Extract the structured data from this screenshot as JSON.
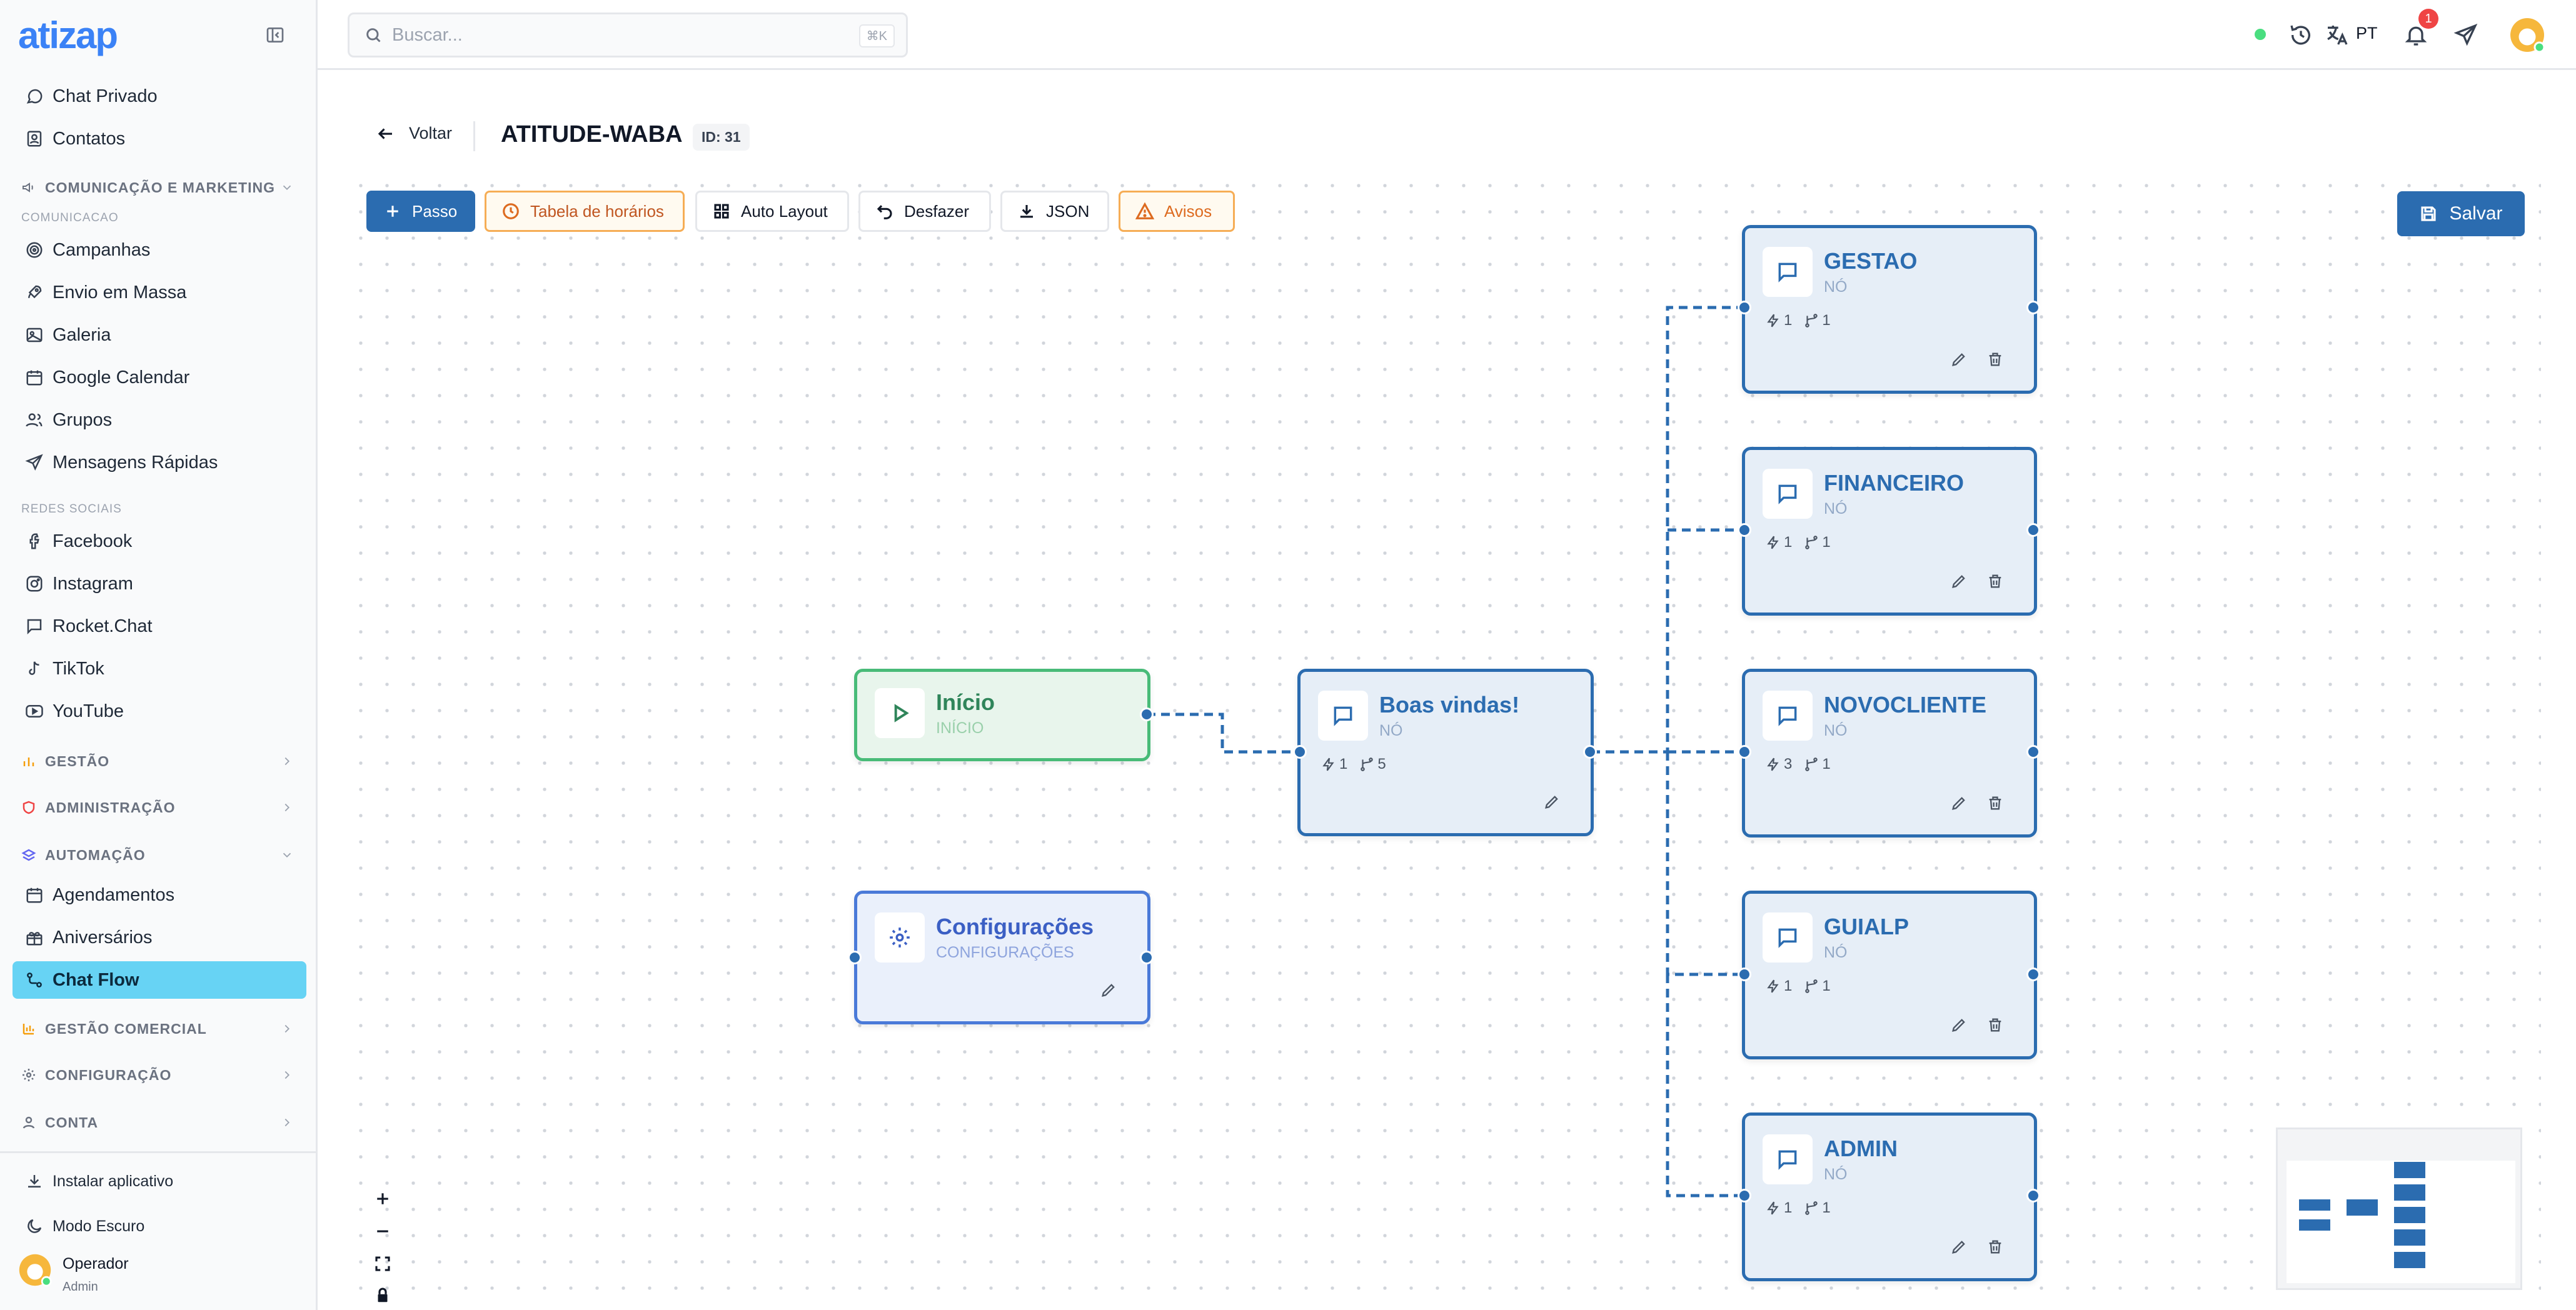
{
  "app": {
    "name": "atizap"
  },
  "sidebar": {
    "top_items": [
      {
        "label": "Chat Privado",
        "icon": "chat-bubble-icon"
      },
      {
        "label": "Contatos",
        "icon": "contacts-icon"
      }
    ],
    "group_comunicacao": {
      "label": "COMUNICAÇÃO E MARKETING",
      "subheading": "COMUNICACAO"
    },
    "comunicacao_items": [
      {
        "label": "Campanhas",
        "icon": "target-icon"
      },
      {
        "label": "Envio em Massa",
        "icon": "rocket-icon"
      },
      {
        "label": "Galeria",
        "icon": "image-icon"
      },
      {
        "label": "Google Calendar",
        "icon": "calendar-icon"
      },
      {
        "label": "Grupos",
        "icon": "users-icon"
      },
      {
        "label": "Mensagens Rápidas",
        "icon": "send-icon"
      }
    ],
    "redes_heading": "REDES SOCIAIS",
    "redes_items": [
      {
        "label": "Facebook",
        "icon": "facebook-icon"
      },
      {
        "label": "Instagram",
        "icon": "instagram-icon"
      },
      {
        "label": "Rocket.Chat",
        "icon": "chat-bubble-icon"
      },
      {
        "label": "TikTok",
        "icon": "tiktok-icon"
      },
      {
        "label": "YouTube",
        "icon": "youtube-icon"
      }
    ],
    "groups": {
      "gestao": "GESTÃO",
      "administracao": "ADMINISTRAÇÃO",
      "automacao": "AUTOMAÇÃO",
      "gestao_comercial": "GESTÃO COMERCIAL",
      "configuracao": "CONFIGURAÇÃO",
      "conta": "CONTA"
    },
    "automacao_items": [
      {
        "label": "Agendamentos",
        "icon": "calendar-icon"
      },
      {
        "label": "Aniversários",
        "icon": "gift-icon"
      },
      {
        "label": "Chat Flow",
        "icon": "flow-icon",
        "active": true
      }
    ],
    "bottom": {
      "install": "Instalar aplicativo",
      "dark_mode": "Modo Escuro",
      "user_name": "Operador",
      "user_role": "Admin"
    }
  },
  "topbar": {
    "search_placeholder": "Buscar...",
    "shortcut": "⌘K",
    "language": "PT",
    "notification_count": "1",
    "status_color": "#4ade80"
  },
  "page": {
    "back_label": "Voltar",
    "title": "ATITUDE-WABA",
    "id_badge": "ID: 31"
  },
  "toolbar": {
    "passo": "Passo",
    "tabela": "Tabela de horários",
    "auto_layout": "Auto Layout",
    "desfazer": "Desfazer",
    "json": "JSON",
    "avisos": "Avisos",
    "salvar": "Salvar"
  },
  "nodes": {
    "inicio": {
      "title": "Início",
      "subtitle": "INÍCIO"
    },
    "config": {
      "title": "Configurações",
      "subtitle": "CONFIGURAÇÕES"
    },
    "boas": {
      "title": "Boas vindas!",
      "subtitle": "NÓ",
      "triggers": "1",
      "branches": "5"
    },
    "gestao": {
      "title": "GESTAO",
      "subtitle": "NÓ",
      "triggers": "1",
      "branches": "1"
    },
    "financeiro": {
      "title": "FINANCEIRO",
      "subtitle": "NÓ",
      "triggers": "1",
      "branches": "1"
    },
    "novocliente": {
      "title": "NOVOCLIENTE",
      "subtitle": "NÓ",
      "triggers": "3",
      "branches": "1"
    },
    "guialp": {
      "title": "GUIALP",
      "subtitle": "NÓ",
      "triggers": "1",
      "branches": "1"
    },
    "admin": {
      "title": "ADMIN",
      "subtitle": "NÓ",
      "triggers": "1",
      "branches": "1"
    }
  },
  "colors": {
    "accent": "#2b6cb0",
    "active_nav": "#67d3f4",
    "start_node": "#48bb78",
    "warning": "#f6ad55"
  }
}
